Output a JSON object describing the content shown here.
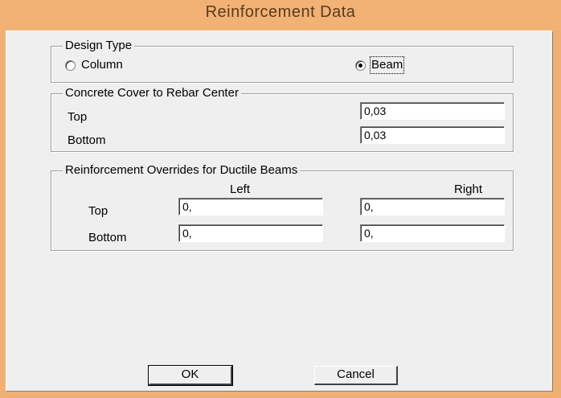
{
  "window": {
    "title": "Reinforcement Data"
  },
  "design_type": {
    "legend": "Design Type",
    "options": [
      {
        "label": "Column",
        "selected": false
      },
      {
        "label": "Beam",
        "selected": true
      }
    ]
  },
  "concrete_cover": {
    "legend": "Concrete Cover to Rebar Center",
    "top_label": "Top",
    "top_value": "0,03",
    "bottom_label": "Bottom",
    "bottom_value": "0,03"
  },
  "overrides": {
    "legend": "Reinforcement Overrides for Ductile Beams",
    "col_left": "Left",
    "col_right": "Right",
    "top_label": "Top",
    "top_left": "0,",
    "top_right": "0,",
    "bottom_label": "Bottom",
    "bottom_left": "0,",
    "bottom_right": "0,"
  },
  "buttons": {
    "ok": "OK",
    "cancel": "Cancel"
  },
  "colors": {
    "title_bar": "#f2b276",
    "dialog_bg": "#efefef"
  }
}
